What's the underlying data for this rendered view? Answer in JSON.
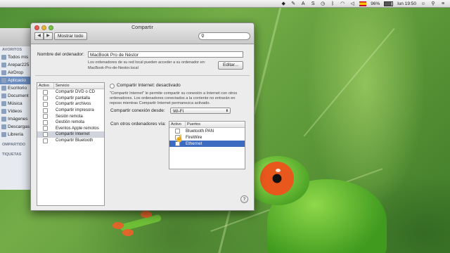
{
  "menubar": {
    "battery": "96%",
    "flag_icon": "spain-flag-icon",
    "clock": "lun 19:50"
  },
  "finder": {
    "section_favorites": "AVORITOS",
    "items": [
      {
        "label": "Todos mis",
        "icon": "folder-icon"
      },
      {
        "label": "Arepar225",
        "icon": "folder-icon"
      },
      {
        "label": "AirDrop",
        "icon": "airdrop-icon"
      },
      {
        "label": "Aplicacio",
        "icon": "applications-icon",
        "selected": true
      },
      {
        "label": "Escritorio",
        "icon": "desktop-icon"
      },
      {
        "label": "Document",
        "icon": "documents-icon"
      },
      {
        "label": "Música",
        "icon": "music-icon"
      },
      {
        "label": "Vídeos",
        "icon": "movies-icon"
      },
      {
        "label": "Imágenes",
        "icon": "pictures-icon"
      },
      {
        "label": "Descargas",
        "icon": "downloads-icon"
      },
      {
        "label": "Librería",
        "icon": "library-icon"
      }
    ],
    "section_shared": "OMPARTIDO",
    "section_tags": "TIQUETAS"
  },
  "window": {
    "title": "Compartir",
    "show_all": "Mostrar todo",
    "search_placeholder": "",
    "computer_name_label": "Nombre del ordenador:",
    "computer_name_value": "MacBook Pro de Néstor",
    "local_info_line1": "Los ordenadores de su red local pueden acceder a su ordenador en:",
    "local_info_line2": "MacBook-Pro-de-Nestor.local",
    "edit_button": "Editar...",
    "services_header_active": "Activo",
    "services_header_service": "Servicio",
    "services": [
      {
        "label": "Compartir DVD o CD",
        "checked": false
      },
      {
        "label": "Compartir pantalla",
        "checked": false
      },
      {
        "label": "Compartir archivos",
        "checked": false
      },
      {
        "label": "Compartir impresora",
        "checked": false
      },
      {
        "label": "Sesión remota",
        "checked": false
      },
      {
        "label": "Gestión remota",
        "checked": false
      },
      {
        "label": "Eventos Apple remotos",
        "checked": false
      },
      {
        "label": "Compartir Internet",
        "checked": false,
        "selected": true
      },
      {
        "label": "Compartir Bluetooth",
        "checked": false
      }
    ],
    "status": "Compartir Internet: desactivado",
    "description_line1": "\"Compartir Internet\" le permite compartir su conexión a Internet con otros",
    "description_line2": "ordenadores. Los ordenadores conectados a la corriente no entrarán en",
    "description_line3": "reposo mientras Compartir Internet permanezca activado.",
    "share_from_label": "Compartir conexión desde:",
    "share_from_value": "Wi-Fi",
    "to_computers_label": "Con otros ordenadores vía:",
    "ports_header_active": "Activo",
    "ports_header_ports": "Puertos",
    "ports": [
      {
        "label": "Bluetooth PAN",
        "checked": false
      },
      {
        "label": "FireWire",
        "checked": false
      },
      {
        "label": "Ethernet",
        "checked": false,
        "selected": true
      }
    ],
    "help": "?"
  }
}
